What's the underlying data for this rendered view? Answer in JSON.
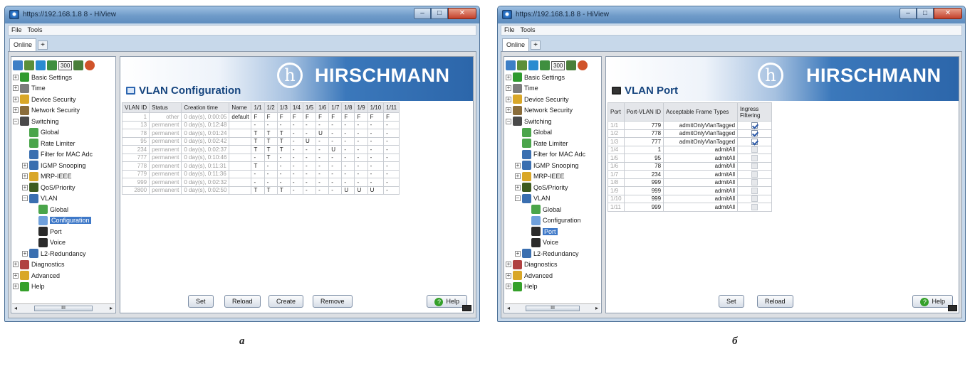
{
  "window_a": {
    "title": "https://192.168.1.8 8 - HiView",
    "menu": [
      "File",
      "Tools"
    ],
    "tab": "Online",
    "tab_add": "+",
    "toolbar_badge": "300",
    "tree": [
      {
        "label": "Basic Settings",
        "level": 0,
        "exp": "+",
        "icon": "star-icon",
        "color": "#2e9a2e"
      },
      {
        "label": "Time",
        "level": 0,
        "exp": "+",
        "icon": "clock-icon",
        "color": "#7c7c7c"
      },
      {
        "label": "Device Security",
        "level": 0,
        "exp": "+",
        "icon": "lock-icon",
        "color": "#d9a728"
      },
      {
        "label": "Network Security",
        "level": 0,
        "exp": "+",
        "icon": "gear-icon",
        "color": "#8a6d3b"
      },
      {
        "label": "Switching",
        "level": 0,
        "exp": "−",
        "icon": "switch-icon",
        "color": "#4a4a4a"
      },
      {
        "label": "Global",
        "level": 1,
        "exp": "",
        "icon": "global-icon",
        "color": "#4aa54a"
      },
      {
        "label": "Rate Limiter",
        "level": 1,
        "exp": "",
        "icon": "rate-icon",
        "color": "#4aa54a"
      },
      {
        "label": "Filter for MAC Adc",
        "level": 1,
        "exp": "",
        "icon": "filter-icon",
        "color": "#3a6fb0"
      },
      {
        "label": "IGMP Snooping",
        "level": 1,
        "exp": "+",
        "icon": "igmp-icon",
        "color": "#3a6fb0"
      },
      {
        "label": "MRP-IEEE",
        "level": 1,
        "exp": "+",
        "icon": "mrp-icon",
        "color": "#d9a728"
      },
      {
        "label": "QoS/Priority",
        "level": 1,
        "exp": "+",
        "icon": "qos-icon",
        "color": "#3d5b1f"
      },
      {
        "label": "VLAN",
        "level": 1,
        "exp": "−",
        "icon": "vlan-icon",
        "color": "#3a6fb0"
      },
      {
        "label": "Global",
        "level": 2,
        "exp": "",
        "icon": "global-icon",
        "color": "#4aa54a"
      },
      {
        "label": "Configuration",
        "level": 2,
        "exp": "",
        "icon": "config-icon",
        "color": "#6fa0dc",
        "selected": true
      },
      {
        "label": "Port",
        "level": 2,
        "exp": "",
        "icon": "port-icon",
        "color": "#2b2b2b"
      },
      {
        "label": "Voice",
        "level": 2,
        "exp": "",
        "icon": "voice-icon",
        "color": "#2b2b2b"
      },
      {
        "label": "L2-Redundancy",
        "level": 1,
        "exp": "+",
        "icon": "redundancy-icon",
        "color": "#3a6fb0"
      },
      {
        "label": "Diagnostics",
        "level": 0,
        "exp": "+",
        "icon": "diagnostics-icon",
        "color": "#b04040"
      },
      {
        "label": "Advanced",
        "level": 0,
        "exp": "+",
        "icon": "star-icon",
        "color": "#d9a728"
      },
      {
        "label": "Help",
        "level": 0,
        "exp": "+",
        "icon": "help-icon",
        "color": "#35a02a"
      }
    ],
    "scroll_thumb": "III",
    "page_title": "VLAN Configuration",
    "logo_mark": "h",
    "logo_text": "HIRSCHMANN",
    "columns": [
      "VLAN ID",
      "Status",
      "Creation time",
      "Name",
      "1/1",
      "1/2",
      "1/3",
      "1/4",
      "1/5",
      "1/6",
      "1/7",
      "1/8",
      "1/9",
      "1/10",
      "1/11"
    ],
    "rows": [
      [
        "1",
        "other",
        "0 day(s), 0:00:05",
        "default",
        "F",
        "F",
        "F",
        "F",
        "F",
        "F",
        "F",
        "F",
        "F",
        "F",
        "F"
      ],
      [
        "13",
        "permanent",
        "0 day(s), 0:12:48",
        "",
        "-",
        "-",
        "-",
        "-",
        "-",
        "-",
        "-",
        "-",
        "-",
        "-",
        "-"
      ],
      [
        "78",
        "permanent",
        "0 day(s), 0:01:24",
        "",
        "T",
        "T",
        "T",
        "-",
        "-",
        "U",
        "-",
        "-",
        "-",
        "-",
        "-"
      ],
      [
        "95",
        "permanent",
        "0 day(s), 0:02:42",
        "",
        "T",
        "T",
        "T",
        "-",
        "U",
        "-",
        "-",
        "-",
        "-",
        "-",
        "-"
      ],
      [
        "234",
        "permanent",
        "0 day(s), 0:02:37",
        "",
        "T",
        "T",
        "T",
        "-",
        "-",
        "-",
        "U",
        "-",
        "-",
        "-",
        "-"
      ],
      [
        "777",
        "permanent",
        "0 day(s), 0:10:46",
        "",
        "-",
        "T",
        "-",
        "-",
        "-",
        "-",
        "-",
        "-",
        "-",
        "-",
        "-"
      ],
      [
        "778",
        "permanent",
        "0 day(s), 0:11:31",
        "",
        "T",
        "-",
        "-",
        "-",
        "-",
        "-",
        "-",
        "-",
        "-",
        "-",
        "-"
      ],
      [
        "779",
        "permanent",
        "0 day(s), 0:11:36",
        "",
        "-",
        "-",
        "-",
        "-",
        "-",
        "-",
        "-",
        "-",
        "-",
        "-",
        "-"
      ],
      [
        "999",
        "permanent",
        "0 day(s), 0:02:32",
        "",
        "-",
        "-",
        "-",
        "-",
        "-",
        "-",
        "-",
        "-",
        "-",
        "-",
        "-"
      ],
      [
        "2800",
        "permanent",
        "0 day(s), 0:02:50",
        "",
        "T",
        "T",
        "T",
        "-",
        "-",
        "-",
        "-",
        "U",
        "U",
        "U",
        "-"
      ]
    ],
    "buttons": {
      "set": "Set",
      "reload": "Reload",
      "create": "Create",
      "remove": "Remove",
      "help": "Help"
    }
  },
  "window_b": {
    "title": "https://192.168.1.8 8 - HiView",
    "menu": [
      "File",
      "Tools"
    ],
    "tab": "Online",
    "tab_add": "+",
    "toolbar_badge": "300",
    "tree": [
      {
        "label": "Basic Settings",
        "level": 0,
        "exp": "+",
        "icon": "star-icon",
        "color": "#2e9a2e"
      },
      {
        "label": "Time",
        "level": 0,
        "exp": "+",
        "icon": "clock-icon",
        "color": "#7c7c7c"
      },
      {
        "label": "Device Security",
        "level": 0,
        "exp": "+",
        "icon": "lock-icon",
        "color": "#d9a728"
      },
      {
        "label": "Network Security",
        "level": 0,
        "exp": "+",
        "icon": "gear-icon",
        "color": "#8a6d3b"
      },
      {
        "label": "Switching",
        "level": 0,
        "exp": "−",
        "icon": "switch-icon",
        "color": "#4a4a4a"
      },
      {
        "label": "Global",
        "level": 1,
        "exp": "",
        "icon": "global-icon",
        "color": "#4aa54a"
      },
      {
        "label": "Rate Limiter",
        "level": 1,
        "exp": "",
        "icon": "rate-icon",
        "color": "#4aa54a"
      },
      {
        "label": "Filter for MAC Adc",
        "level": 1,
        "exp": "",
        "icon": "filter-icon",
        "color": "#3a6fb0"
      },
      {
        "label": "IGMP Snooping",
        "level": 1,
        "exp": "+",
        "icon": "igmp-icon",
        "color": "#3a6fb0"
      },
      {
        "label": "MRP-IEEE",
        "level": 1,
        "exp": "+",
        "icon": "mrp-icon",
        "color": "#d9a728"
      },
      {
        "label": "QoS/Priority",
        "level": 1,
        "exp": "+",
        "icon": "qos-icon",
        "color": "#3d5b1f"
      },
      {
        "label": "VLAN",
        "level": 1,
        "exp": "−",
        "icon": "vlan-icon",
        "color": "#3a6fb0"
      },
      {
        "label": "Global",
        "level": 2,
        "exp": "",
        "icon": "global-icon",
        "color": "#4aa54a"
      },
      {
        "label": "Configuration",
        "level": 2,
        "exp": "",
        "icon": "config-icon",
        "color": "#6fa0dc"
      },
      {
        "label": "Port",
        "level": 2,
        "exp": "",
        "icon": "port-icon",
        "color": "#2b2b2b",
        "selected": true
      },
      {
        "label": "Voice",
        "level": 2,
        "exp": "",
        "icon": "voice-icon",
        "color": "#2b2b2b"
      },
      {
        "label": "L2-Redundancy",
        "level": 1,
        "exp": "+",
        "icon": "redundancy-icon",
        "color": "#3a6fb0"
      },
      {
        "label": "Diagnostics",
        "level": 0,
        "exp": "+",
        "icon": "diagnostics-icon",
        "color": "#b04040"
      },
      {
        "label": "Advanced",
        "level": 0,
        "exp": "+",
        "icon": "star-icon",
        "color": "#d9a728"
      },
      {
        "label": "Help",
        "level": 0,
        "exp": "+",
        "icon": "help-icon",
        "color": "#35a02a"
      }
    ],
    "scroll_thumb": "III",
    "page_title": "VLAN Port",
    "logo_mark": "h",
    "logo_text": "HIRSCHMANN",
    "columns": [
      "Port",
      "Port-VLAN ID",
      "Acceptable Frame Types",
      "Ingress Filtering"
    ],
    "rows": [
      {
        "port": "1/1",
        "pvid": "779",
        "frame": "admitOnlyVlanTagged",
        "ingress": true
      },
      {
        "port": "1/2",
        "pvid": "778",
        "frame": "admitOnlyVlanTagged",
        "ingress": true
      },
      {
        "port": "1/3",
        "pvid": "777",
        "frame": "admitOnlyVlanTagged",
        "ingress": true
      },
      {
        "port": "1/4",
        "pvid": "1",
        "frame": "admitAll",
        "ingress": false
      },
      {
        "port": "1/5",
        "pvid": "95",
        "frame": "admitAll",
        "ingress": false
      },
      {
        "port": "1/6",
        "pvid": "78",
        "frame": "admitAll",
        "ingress": false
      },
      {
        "port": "1/7",
        "pvid": "234",
        "frame": "admitAll",
        "ingress": false
      },
      {
        "port": "1/8",
        "pvid": "999",
        "frame": "admitAll",
        "ingress": false
      },
      {
        "port": "1/9",
        "pvid": "999",
        "frame": "admitAll",
        "ingress": false
      },
      {
        "port": "1/10",
        "pvid": "999",
        "frame": "admitAll",
        "ingress": false
      },
      {
        "port": "1/11",
        "pvid": "999",
        "frame": "admitAll",
        "ingress": false
      }
    ],
    "buttons": {
      "set": "Set",
      "reload": "Reload",
      "help": "Help"
    }
  },
  "captions": {
    "a": "a",
    "b": "б"
  }
}
